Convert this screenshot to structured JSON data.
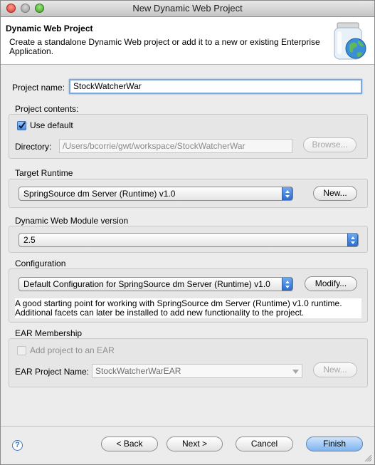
{
  "window": {
    "title": "New Dynamic Web Project"
  },
  "banner": {
    "title": "Dynamic Web Project",
    "description": "Create a standalone Dynamic Web project or add it to a new or existing Enterprise Application.",
    "icon": "jar-globe-icon"
  },
  "project_name": {
    "label": "Project name:",
    "value": "StockWatcherWar"
  },
  "project_contents": {
    "label": "Project contents:",
    "use_default_label": "Use default",
    "use_default_checked": true,
    "directory_label": "Directory:",
    "directory_value": "/Users/bcorrie/gwt/workspace/StockWatcherWar",
    "browse_label": "Browse..."
  },
  "target_runtime": {
    "label": "Target Runtime",
    "selected": "SpringSource dm Server (Runtime) v1.0",
    "new_label": "New..."
  },
  "web_module": {
    "label": "Dynamic Web Module version",
    "selected": "2.5"
  },
  "configuration": {
    "label": "Configuration",
    "selected": "Default Configuration for SpringSource dm Server (Runtime) v1.0",
    "modify_label": "Modify...",
    "description": "A good starting point for working with SpringSource dm Server (Runtime) v1.0 runtime. Additional facets can later be installed to add new functionality to the project."
  },
  "ear": {
    "label": "EAR Membership",
    "add_label": "Add project to an EAR",
    "add_checked": false,
    "project_name_label": "EAR Project Name:",
    "project_name_value": "StockWatcherWarEAR",
    "new_label": "New..."
  },
  "buttons": {
    "back": "< Back",
    "next": "Next >",
    "cancel": "Cancel",
    "finish": "Finish",
    "help": "?"
  },
  "colors": {
    "accent": "#7fb4ef",
    "focus_ring": "#7ea7dc"
  }
}
